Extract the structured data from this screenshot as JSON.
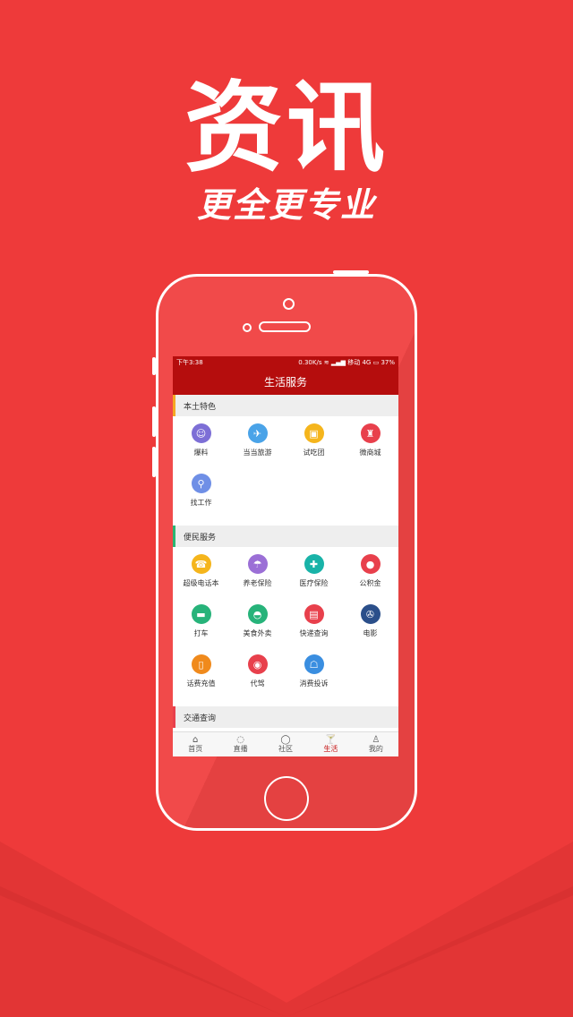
{
  "promo": {
    "title": "资讯",
    "subtitle": "更全更专业"
  },
  "status_bar": {
    "time": "下午3:38",
    "speed": "0.30K/s",
    "carrier": "移动",
    "network": "4G",
    "battery": "37%"
  },
  "nav": {
    "title": "生活服务"
  },
  "sections": [
    {
      "title": "本土特色",
      "accent": "#f5a623",
      "items": [
        {
          "label": "爆料",
          "icon": "reporter-icon",
          "glyph": "☺",
          "color": "#7d6fd6"
        },
        {
          "label": "当当旅游",
          "icon": "travel-icon",
          "glyph": "✈",
          "color": "#4aa3e8"
        },
        {
          "label": "试吃团",
          "icon": "tasting-icon",
          "glyph": "▣",
          "color": "#f5b51c"
        },
        {
          "label": "微商城",
          "icon": "shop-icon",
          "glyph": "♜",
          "color": "#e8404c"
        },
        {
          "label": "找工作",
          "icon": "job-search-icon",
          "glyph": "⚲",
          "color": "#6f8fe6"
        }
      ]
    },
    {
      "title": "便民服务",
      "accent": "#2bb673",
      "items": [
        {
          "label": "超级电话本",
          "icon": "phonebook-icon",
          "glyph": "☎",
          "color": "#f5b51c"
        },
        {
          "label": "养老保险",
          "icon": "umbrella-icon",
          "glyph": "☂",
          "color": "#9b6fd6"
        },
        {
          "label": "医疗保险",
          "icon": "medical-icon",
          "glyph": "✚",
          "color": "#19b3a8"
        },
        {
          "label": "公积金",
          "icon": "piggybank-icon",
          "glyph": "●",
          "color": "#e8404c"
        },
        {
          "label": "打车",
          "icon": "taxi-icon",
          "glyph": "▬",
          "color": "#27b37a"
        },
        {
          "label": "美食外卖",
          "icon": "food-icon",
          "glyph": "◓",
          "color": "#27b37a"
        },
        {
          "label": "快递查询",
          "icon": "delivery-icon",
          "glyph": "▤",
          "color": "#e8404c"
        },
        {
          "label": "电影",
          "icon": "film-icon",
          "glyph": "✇",
          "color": "#2b4f8a"
        },
        {
          "label": "话费充值",
          "icon": "phone-recharge-icon",
          "glyph": "▯",
          "color": "#f08a1c"
        },
        {
          "label": "代驾",
          "icon": "designated-driver-icon",
          "glyph": "◉",
          "color": "#e8404c"
        },
        {
          "label": "消费投诉",
          "icon": "complaint-icon",
          "glyph": "☖",
          "color": "#3a8ee0"
        }
      ]
    },
    {
      "title": "交通查询",
      "accent": "#e8404c",
      "items": [
        {
          "label": "",
          "icon": "flight-icon",
          "glyph": "✈",
          "color": "#27b37a"
        },
        {
          "label": "",
          "icon": "train-icon",
          "glyph": "▦",
          "color": "#6f8fe6"
        },
        {
          "label": "",
          "icon": "car-icon",
          "glyph": "◆",
          "color": "#f5c81c"
        },
        {
          "label": "",
          "icon": "bus-icon",
          "glyph": "▭",
          "color": "#2b5fa8"
        }
      ]
    }
  ],
  "tabs": [
    {
      "label": "首页",
      "icon": "home-icon",
      "glyph": "⌂",
      "active": false
    },
    {
      "label": "直播",
      "icon": "live-icon",
      "glyph": "◌",
      "active": false
    },
    {
      "label": "社区",
      "icon": "community-icon",
      "glyph": "◯",
      "active": false
    },
    {
      "label": "生活",
      "icon": "life-icon",
      "glyph": "🍸",
      "active": true
    },
    {
      "label": "我的",
      "icon": "profile-icon",
      "glyph": "♙",
      "active": false
    }
  ]
}
